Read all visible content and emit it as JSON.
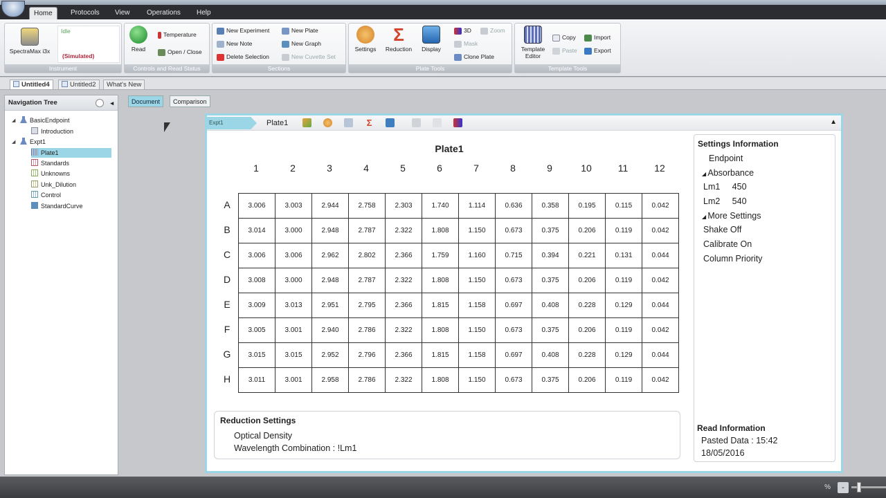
{
  "menu": {
    "tabs": [
      "Home",
      "Protocols",
      "View",
      "Operations",
      "Help"
    ]
  },
  "ribbon": {
    "instrument": {
      "device_label": "SpectraMax i3x",
      "status": "Idle",
      "mode": "(Simulated)",
      "group": "Instrument"
    },
    "controls": {
      "read": "Read",
      "temperature": "Temperature",
      "open_close": "Open / Close",
      "group": "Controls and Read Status"
    },
    "sections": {
      "new_experiment": "New Experiment",
      "new_note": "New Note",
      "delete_selection": "Delete Selection",
      "new_plate": "New Plate",
      "new_graph": "New Graph",
      "new_cuvette_set": "New Cuvette Set",
      "group": "Sections"
    },
    "plate_tools": {
      "settings": "Settings",
      "reduction": "Reduction",
      "display": "Display",
      "three_d": "3D",
      "zoom": "Zoom",
      "mask": "Mask",
      "clone_plate": "Clone Plate",
      "group": "Plate Tools"
    },
    "template_tools": {
      "template_editor": "Template Editor",
      "copy": "Copy",
      "paste": "Paste",
      "import": "Import",
      "export": "Export",
      "group": "Template Tools"
    }
  },
  "doc_tabs": [
    "Untitled4",
    "Untitled2",
    "What's New"
  ],
  "nav": {
    "title": "Navigation Tree",
    "items": [
      "BasicEndpoint",
      "Introduction",
      "Expt1",
      "Plate1",
      "Standards",
      "Unknowns",
      "Unk_Dilution",
      "Control",
      "StandardCurve"
    ]
  },
  "view_tabs": [
    "Document",
    "Comparison"
  ],
  "breadcrumb": {
    "experiment": "Expt1",
    "plate": "Plate1"
  },
  "plate": {
    "title": "Plate1",
    "columns": [
      "1",
      "2",
      "3",
      "4",
      "5",
      "6",
      "7",
      "8",
      "9",
      "10",
      "11",
      "12"
    ],
    "rows": [
      "A",
      "B",
      "C",
      "D",
      "E",
      "F",
      "G",
      "H"
    ],
    "values": [
      [
        "3.006",
        "3.003",
        "2.944",
        "2.758",
        "2.303",
        "1.740",
        "1.114",
        "0.636",
        "0.358",
        "0.195",
        "0.115",
        "0.042"
      ],
      [
        "3.014",
        "3.000",
        "2.948",
        "2.787",
        "2.322",
        "1.808",
        "1.150",
        "0.673",
        "0.375",
        "0.206",
        "0.119",
        "0.042"
      ],
      [
        "3.006",
        "3.006",
        "2.962",
        "2.802",
        "2.366",
        "1.759",
        "1.160",
        "0.715",
        "0.394",
        "0.221",
        "0.131",
        "0.044"
      ],
      [
        "3.008",
        "3.000",
        "2.948",
        "2.787",
        "2.322",
        "1.808",
        "1.150",
        "0.673",
        "0.375",
        "0.206",
        "0.119",
        "0.042"
      ],
      [
        "3.009",
        "3.013",
        "2.951",
        "2.795",
        "2.366",
        "1.815",
        "1.158",
        "0.697",
        "0.408",
        "0.228",
        "0.129",
        "0.044"
      ],
      [
        "3.005",
        "3.001",
        "2.940",
        "2.786",
        "2.322",
        "1.808",
        "1.150",
        "0.673",
        "0.375",
        "0.206",
        "0.119",
        "0.042"
      ],
      [
        "3.015",
        "3.015",
        "2.952",
        "2.796",
        "2.366",
        "1.815",
        "1.158",
        "0.697",
        "0.408",
        "0.228",
        "0.129",
        "0.044"
      ],
      [
        "3.011",
        "3.001",
        "2.958",
        "2.786",
        "2.322",
        "1.808",
        "1.150",
        "0.673",
        "0.375",
        "0.206",
        "0.119",
        "0.042"
      ]
    ]
  },
  "settings_info": {
    "title": "Settings Information",
    "lines": [
      "Endpoint",
      "Absorbance",
      "Lm1     450",
      "Lm2     540",
      "More Settings",
      "Shake  Off",
      "Calibrate  On",
      "Column Priority"
    ]
  },
  "reduction": {
    "title": "Reduction Settings",
    "line1": "Optical Density",
    "line2": "Wavelength Combination : !Lm1"
  },
  "read_info": {
    "title": "Read Information",
    "line1": "Pasted Data : 15:42",
    "line2": "18/05/2016"
  },
  "status": {
    "zoom_symbol": "%",
    "zoom_minus": "-"
  },
  "colors": {
    "accent": "#9ad6e6",
    "ribbon_label": "#b6bbc2",
    "menubar": "#2b2d31"
  }
}
